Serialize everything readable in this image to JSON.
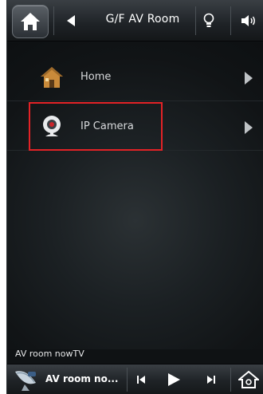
{
  "header": {
    "title": "G/F AV Room",
    "icons": [
      "home-icon",
      "back-arrow-icon",
      "bulb-icon",
      "volume-icon"
    ]
  },
  "menu": {
    "items": [
      {
        "label": "Home",
        "icon": "house-icon"
      },
      {
        "label": "IP Camera",
        "icon": "webcam-icon"
      }
    ]
  },
  "now_playing": {
    "label": "AV room nowTV",
    "short_label": "AV room no..."
  },
  "colors": {
    "highlight": "#e32226",
    "background": "#0f1214",
    "text": "#ffffff"
  }
}
